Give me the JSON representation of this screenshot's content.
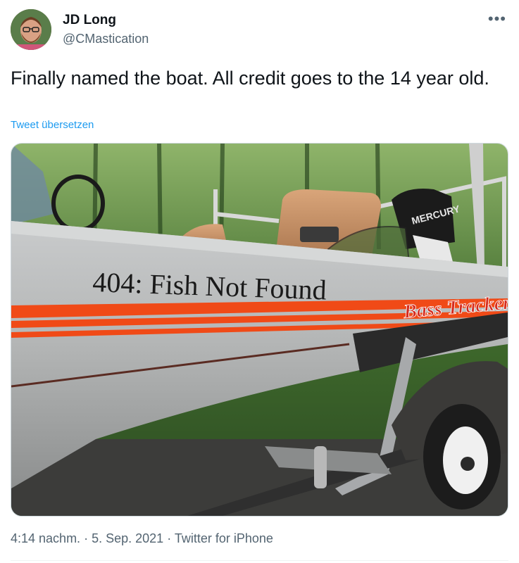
{
  "author": {
    "name": "JD Long",
    "handle": "@CMastication"
  },
  "more_icon": "more-horizontal-icon",
  "tweet": {
    "text": "Finally named the boat. All credit goes to the 14 year old.",
    "translate_label": "Tweet übersetzen"
  },
  "image": {
    "hull_lettering": "404: Fish Not Found",
    "brand_lettering": "Bass Tracker",
    "engine_lettering": "MERCURY"
  },
  "meta": {
    "time": "4:14 nachm.",
    "date": "5. Sep. 2021",
    "source": "Twitter for iPhone"
  },
  "colors": {
    "link": "#1d9bf0",
    "secondary_text": "#536471",
    "stripe_orange": "#f04a17",
    "brand_red": "#d42a1e"
  }
}
